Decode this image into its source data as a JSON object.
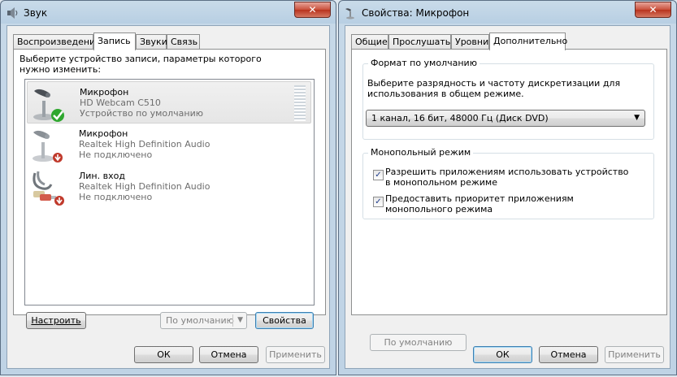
{
  "sound_dialog": {
    "title": "Звук",
    "close": "✕",
    "tabs": [
      "Воспроизведение",
      "Запись",
      "Звуки",
      "Связь"
    ],
    "instruction": "Выберите устройство записи, параметры которого нужно изменить:",
    "devices": [
      {
        "name": "Микрофон",
        "detail": "HD Webcam C510",
        "status": "Устройство по умолчанию",
        "state": "default"
      },
      {
        "name": "Микрофон",
        "detail": "Realtek High Definition Audio",
        "status": "Не подключено",
        "state": "disconnected"
      },
      {
        "name": "Лин. вход",
        "detail": "Realtek High Definition Audio",
        "status": "Не подключено",
        "state": "disconnected"
      }
    ],
    "configure_label": "Настроить",
    "set_default_label": "По умолчанию",
    "properties_label": "Свойства",
    "ok_label": "ОК",
    "cancel_label": "Отмена",
    "apply_label": "Применить"
  },
  "properties_dialog": {
    "title": "Свойства: Микрофон",
    "close": "✕",
    "tabs": [
      "Общие",
      "Прослушать",
      "Уровни",
      "Дополнительно"
    ],
    "format_group_title": "Формат по умолчанию",
    "format_description": "Выберите разрядность и частоту дискретизации для использования в общем режиме.",
    "format_value": "1 канал, 16 бит, 48000 Гц (Диск DVD)",
    "exclusive_group_title": "Монопольный режим",
    "exclusive_options": [
      {
        "label": "Разрешить приложениям использовать устройство в монопольном режиме",
        "checked": true
      },
      {
        "label": "Предоставить приоритет приложениям монопольного режима",
        "checked": true
      }
    ],
    "restore_defaults_label": "По умолчанию",
    "ok_label": "ОК",
    "cancel_label": "Отмена",
    "apply_label": "Применить"
  },
  "colors": {
    "accent": "#3c7fb1",
    "check_green": "#2fa72f",
    "status_red": "#c0392b"
  }
}
